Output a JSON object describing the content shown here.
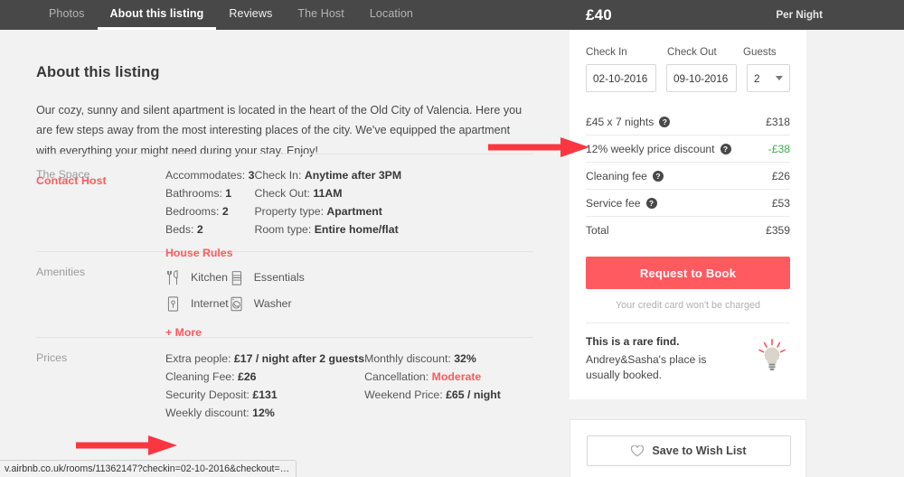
{
  "nav": {
    "tabs": [
      {
        "label": "Photos",
        "state": "dim"
      },
      {
        "label": "About this listing",
        "state": "active"
      },
      {
        "label": "Reviews",
        "state": "bright"
      },
      {
        "label": "The Host",
        "state": "dim"
      },
      {
        "label": "Location",
        "state": "dim"
      }
    ]
  },
  "listing": {
    "title": "About this listing",
    "description": "Our cozy, sunny and silent apartment is located in the heart of the Old City of Valencia. Here you are few steps away from the most interesting places of the city. We've equipped the apartment with everything your might need during your stay. Enjoy!",
    "contact_host": "Contact Host"
  },
  "space": {
    "label": "The Space",
    "left": [
      {
        "key": "Accommodates:",
        "value": "3"
      },
      {
        "key": "Bathrooms:",
        "value": "1"
      },
      {
        "key": "Bedrooms:",
        "value": "2"
      },
      {
        "key": "Beds:",
        "value": "2"
      }
    ],
    "house_rules": "House Rules",
    "right": [
      {
        "key": "Check In:",
        "value": "Anytime after 3PM"
      },
      {
        "key": "Check Out:",
        "value": "11AM"
      },
      {
        "key": "Property type:",
        "value": "Apartment"
      },
      {
        "key": "Room type:",
        "value": "Entire home/flat"
      }
    ]
  },
  "amenities": {
    "label": "Amenities",
    "left": [
      {
        "name": "Kitchen",
        "icon": "kitchen-icon"
      },
      {
        "name": "Internet",
        "icon": "internet-icon"
      }
    ],
    "right": [
      {
        "name": "Essentials",
        "icon": "essentials-icon"
      },
      {
        "name": "Washer",
        "icon": "washer-icon"
      }
    ],
    "more": "+ More"
  },
  "prices": {
    "label": "Prices",
    "left": [
      {
        "key": "Extra people:",
        "value": "£17 / night after 2 guests"
      },
      {
        "key": "Cleaning Fee:",
        "value": "£26"
      },
      {
        "key": "Security Deposit:",
        "value": "£131"
      },
      {
        "key": "Weekly discount:",
        "value": "12%"
      }
    ],
    "right": [
      {
        "key": "Monthly discount:",
        "value": "32%"
      },
      {
        "key": "Cancellation:",
        "value": "Moderate",
        "style": "red"
      },
      {
        "key": "Weekend Price:",
        "value": "£65 / night"
      }
    ]
  },
  "booking": {
    "price": "£40",
    "per_night": "Per Night",
    "checkin_label": "Check In",
    "checkout_label": "Check Out",
    "guests_label": "Guests",
    "checkin_value": "02-10-2016",
    "checkout_value": "09-10-2016",
    "guests_value": "2",
    "rows": [
      {
        "label": "£45 x 7 nights",
        "help": true,
        "amount": "£318",
        "amount_style": "plain"
      },
      {
        "label": "12% weekly price discount",
        "help": true,
        "amount": "-£38",
        "amount_style": "green"
      },
      {
        "label": "Cleaning fee",
        "help": true,
        "amount": "£26",
        "amount_style": "plain"
      },
      {
        "label": "Service fee",
        "help": true,
        "amount": "£53",
        "amount_style": "plain"
      },
      {
        "label": "Total",
        "help": false,
        "amount": "£359",
        "amount_style": "plain"
      }
    ],
    "request_button": "Request to Book",
    "no_charge_note": "Your credit card won't be charged",
    "rare_title": "This is a rare find.",
    "rare_sub": "Andrey&Sasha's place is usually booked.",
    "wish_button": "Save to Wish List",
    "help_glyph": "?"
  },
  "statusbar": {
    "url": "v.airbnb.co.uk/rooms/11362147?checkin=02-10-2016&checkout=…"
  },
  "colors": {
    "brand_red": "#ff5a5f",
    "annotation_red": "#fb3640",
    "discount_green": "#3ab04a",
    "dark_bar": "#484848",
    "page_bg": "#f2f2f2"
  }
}
